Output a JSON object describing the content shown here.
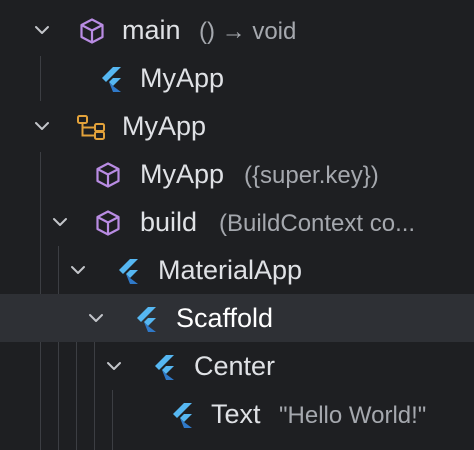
{
  "tree": {
    "rows": [
      {
        "label": "main",
        "detail": "() → void",
        "icon": "method-cube-icon",
        "expanded": true
      },
      {
        "label": "MyApp",
        "detail": "",
        "icon": "flutter-widget-icon",
        "expanded": null
      },
      {
        "label": "MyApp",
        "detail": "",
        "icon": "class-hierarchy-icon",
        "expanded": true
      },
      {
        "label": "MyApp",
        "detail": "({super.key})",
        "icon": "method-cube-icon",
        "expanded": null
      },
      {
        "label": "build",
        "detail": "(BuildContext co...",
        "icon": "method-cube-icon",
        "expanded": true
      },
      {
        "label": "MaterialApp",
        "detail": "",
        "icon": "flutter-widget-icon",
        "expanded": true
      },
      {
        "label": "Scaffold",
        "detail": "",
        "icon": "flutter-widget-icon",
        "expanded": true,
        "selected": true
      },
      {
        "label": "Center",
        "detail": "",
        "icon": "flutter-widget-icon",
        "expanded": true
      },
      {
        "label": "Text",
        "detail": "\"Hello World!\"",
        "icon": "flutter-widget-icon",
        "expanded": null
      }
    ]
  },
  "colors": {
    "background": "#1e1f22",
    "selected_row": "#2e3035",
    "text": "#dfe1e5",
    "detail_text": "#a5a8ae",
    "cube_icon": "#b98ce3",
    "class_icon": "#e3a23b",
    "flutter_light": "#56b7f2",
    "flutter_dark": "#2f79c9"
  }
}
